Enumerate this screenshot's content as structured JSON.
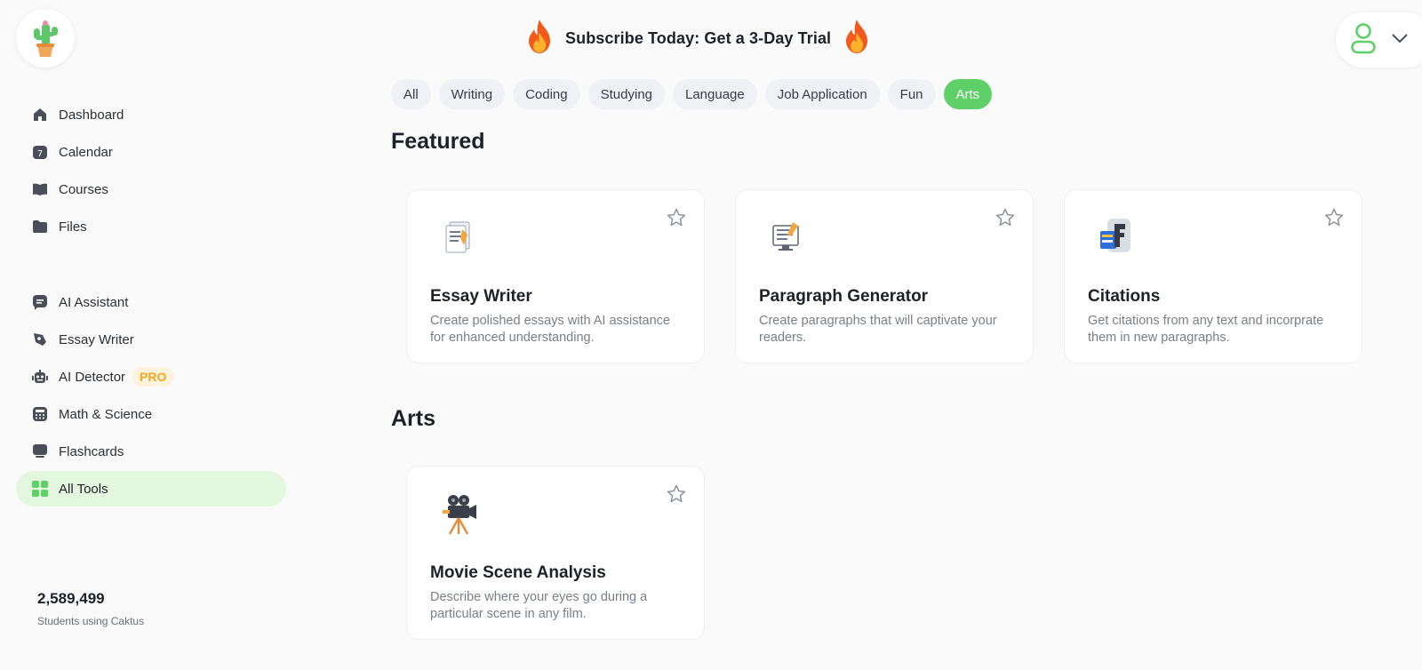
{
  "header": {
    "promo_text": "Subscribe Today: Get a 3-Day Trial"
  },
  "sidebar": {
    "primary_items": [
      {
        "label": "Dashboard",
        "icon": "home-icon"
      },
      {
        "label": "Calendar",
        "icon": "calendar-icon"
      },
      {
        "label": "Courses",
        "icon": "book-icon"
      },
      {
        "label": "Files",
        "icon": "folder-icon"
      }
    ],
    "tool_items": [
      {
        "label": "AI Assistant",
        "icon": "chat-icon"
      },
      {
        "label": "Essay Writer",
        "icon": "pen-icon"
      },
      {
        "label": "AI Detector",
        "icon": "robot-icon",
        "badge": "PRO"
      },
      {
        "label": "Math & Science",
        "icon": "calculator-icon"
      },
      {
        "label": "Flashcards",
        "icon": "flashcard-icon"
      },
      {
        "label": "All Tools",
        "icon": "grid-icon",
        "active": true
      }
    ],
    "stats": {
      "number": "2,589,499",
      "label": "Students using Caktus"
    }
  },
  "tabs": [
    {
      "label": "All"
    },
    {
      "label": "Writing"
    },
    {
      "label": "Coding"
    },
    {
      "label": "Studying"
    },
    {
      "label": "Language"
    },
    {
      "label": "Job Application"
    },
    {
      "label": "Fun"
    },
    {
      "label": "Arts",
      "active": true
    }
  ],
  "sections": {
    "featured": {
      "title": "Featured",
      "cards": [
        {
          "title": "Essay Writer",
          "description": "Create polished essays with AI assistance for enhanced understanding.",
          "icon": "document-icon"
        },
        {
          "title": "Paragraph Generator",
          "description": "Create paragraphs that will captivate your readers.",
          "icon": "monitor-pencil-icon"
        },
        {
          "title": "Citations",
          "description": "Get citations from any text and incorprate them in new paragraphs.",
          "icon": "citation-book-icon"
        }
      ]
    },
    "arts": {
      "title": "Arts",
      "cards": [
        {
          "title": "Movie Scene Analysis",
          "description": "Describe where your eyes go during a particular scene in any film.",
          "icon": "movie-camera-icon"
        }
      ]
    }
  },
  "colors": {
    "accent": "#5fd068",
    "active_bg": "#e3f7df",
    "pro_badge": "#f5a524",
    "background": "#fafafa"
  }
}
